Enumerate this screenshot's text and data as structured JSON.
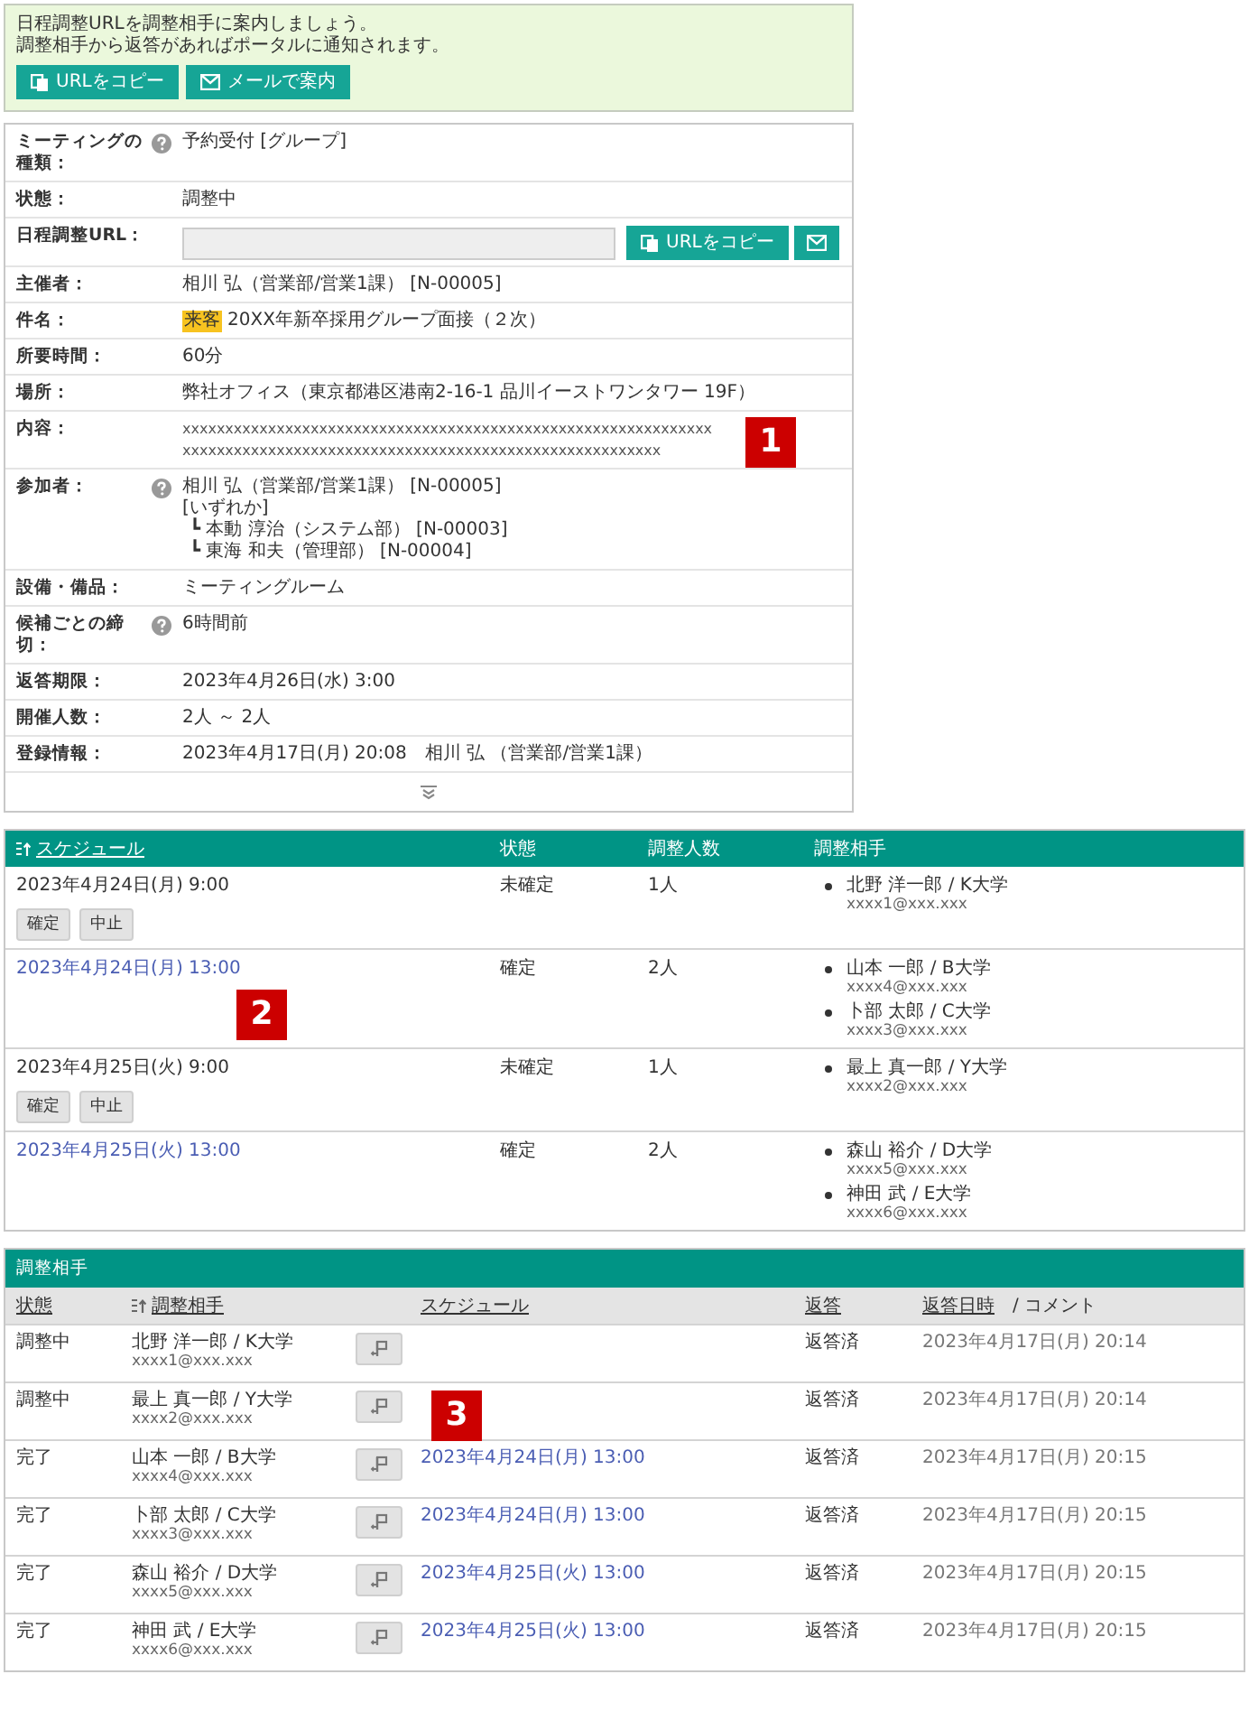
{
  "notice": {
    "lines": [
      "日程調整URLを調整相手に案内しましょう。",
      "調整相手から返答があればポータルに通知されます。"
    ],
    "buttons": [
      {
        "kind": "copy",
        "label": "URLをコピー"
      },
      {
        "kind": "mail",
        "label": "メールで案内"
      }
    ]
  },
  "details": {
    "rows": [
      {
        "kind": "text",
        "label": "ミーティングの種類：",
        "help": true,
        "value": "予約受付 [グループ]"
      },
      {
        "kind": "text",
        "label": "状態：",
        "help": false,
        "value": "調整中"
      },
      {
        "kind": "url",
        "label": "日程調整URL：",
        "help": false,
        "buttons": [
          {
            "kind": "copy",
            "label": "URLをコピー"
          },
          {
            "kind": "mail"
          }
        ]
      },
      {
        "kind": "text",
        "label": "主催者：",
        "help": false,
        "value": "相川 弘（営業部/営業1課） [N-00005]"
      },
      {
        "kind": "tagged",
        "label": "件名：",
        "help": false,
        "tag": "来客",
        "value": "20XX年新卒採用グループ面接（２次）"
      },
      {
        "kind": "text",
        "label": "所要時間：",
        "help": false,
        "value": "60分"
      },
      {
        "kind": "text",
        "label": "場所：",
        "help": false,
        "value": "弊社オフィス（東京都港区港南2-16-1 品川イーストワンタワー 19F）"
      },
      {
        "kind": "text",
        "label": "内容：",
        "help": false,
        "value": "xxxxxxxxxxxxxxxxxxxxxxxxxxxxxxxxxxxxxxxxxxxxxxxxxxxxxxxxxxxxxxxxxxxxxxxxxxxxxxxxxxxxxxxxxxxxxxxxxxxxxxxxxxxxxxxxxxxxxx",
        "marker": "1"
      },
      {
        "kind": "attendees",
        "label": "参加者：",
        "help": true,
        "lines": [
          {
            "text": "相川 弘（営業部/営業1課） [N-00005]"
          },
          {
            "text": "[いずれか]",
            "children": [
              {
                "text": "┗ 本動 淳治（システム部） [N-00003]"
              },
              {
                "text": "┗ 東海 和夫（管理部） [N-00004]"
              }
            ]
          }
        ]
      },
      {
        "kind": "text",
        "label": "設備・備品：",
        "help": false,
        "value": "ミーティングルーム"
      },
      {
        "kind": "text",
        "label": "候補ごとの締切：",
        "help": true,
        "value": "6時間前"
      },
      {
        "kind": "text",
        "label": "返答期限：",
        "help": false,
        "value": "2023年4月26日(水) 3:00"
      },
      {
        "kind": "text",
        "label": "開催人数：",
        "help": false,
        "value": "2人 ～ 2人"
      },
      {
        "kind": "text",
        "label": "登録情報：",
        "help": false,
        "value": "2023年4月17日(月) 20:08　相川 弘 （営業部/営業1課）"
      }
    ]
  },
  "schedule": {
    "columns": [
      {
        "label": "スケジュール",
        "sortable": true
      },
      {
        "label": "状態",
        "sortable": false
      },
      {
        "label": "調整人数",
        "sortable": false
      },
      {
        "label": "調整相手",
        "sortable": false
      }
    ],
    "rows": [
      {
        "date": "2023年4月24日(月) 9:00",
        "confirmed": false,
        "status": "未確定",
        "count": "1人",
        "partners": [
          {
            "name": "北野 洋一郎 / K大学",
            "email": "xxxx1@xxx.xxx"
          }
        ],
        "actions": [
          "確定",
          "中止"
        ]
      },
      {
        "date": "2023年4月24日(月) 13:00",
        "confirmed": true,
        "status": "確定",
        "count": "2人",
        "partners": [
          {
            "name": "山本 一郎 / B大学",
            "email": "xxxx4@xxx.xxx"
          },
          {
            "name": "卜部 太郎 / C大学",
            "email": "xxxx3@xxx.xxx"
          }
        ],
        "marker": "2"
      },
      {
        "date": "2023年4月25日(火) 9:00",
        "confirmed": false,
        "status": "未確定",
        "count": "1人",
        "partners": [
          {
            "name": "最上 真一郎 / Y大学",
            "email": "xxxx2@xxx.xxx"
          }
        ],
        "actions": [
          "確定",
          "中止"
        ]
      },
      {
        "date": "2023年4月25日(火) 13:00",
        "confirmed": true,
        "status": "確定",
        "count": "2人",
        "partners": [
          {
            "name": "森山 裕介 / D大学",
            "email": "xxxx5@xxx.xxx"
          },
          {
            "name": "神田 武 / E大学",
            "email": "xxxx6@xxx.xxx"
          }
        ]
      }
    ]
  },
  "partners": {
    "title": "調整相手",
    "columns": [
      {
        "label": "状態",
        "sortable": false
      },
      {
        "label": "調整相手",
        "sortable": true
      },
      {
        "label": "スケジュール",
        "sortable": false
      },
      {
        "label": "返答",
        "sortable": false
      },
      {
        "label": "返答日時",
        "sortable": false,
        "extra": "/ コメント"
      }
    ],
    "rows": [
      {
        "status": "調整中",
        "name": "北野 洋一郎 / K大学",
        "email": "xxxx1@xxx.xxx",
        "reply": "返答済",
        "replied_at": "2023年4月17日(月) 20:14"
      },
      {
        "status": "調整中",
        "name": "最上 真一郎 / Y大学",
        "email": "xxxx2@xxx.xxx",
        "reply": "返答済",
        "replied_at": "2023年4月17日(月) 20:14",
        "marker": "3"
      },
      {
        "status": "完了",
        "name": "山本 一郎 / B大学",
        "email": "xxxx4@xxx.xxx",
        "schedule": "2023年4月24日(月) 13:00",
        "reply": "返答済",
        "replied_at": "2023年4月17日(月) 20:15"
      },
      {
        "status": "完了",
        "name": "卜部 太郎 / C大学",
        "email": "xxxx3@xxx.xxx",
        "schedule": "2023年4月24日(月) 13:00",
        "reply": "返答済",
        "replied_at": "2023年4月17日(月) 20:15"
      },
      {
        "status": "完了",
        "name": "森山 裕介 / D大学",
        "email": "xxxx5@xxx.xxx",
        "schedule": "2023年4月25日(火) 13:00",
        "reply": "返答済",
        "replied_at": "2023年4月17日(月) 20:15"
      },
      {
        "status": "完了",
        "name": "神田 武 / E大学",
        "email": "xxxx6@xxx.xxx",
        "schedule": "2023年4月25日(火) 13:00",
        "reply": "返答済",
        "replied_at": "2023年4月17日(月) 20:15"
      }
    ]
  }
}
